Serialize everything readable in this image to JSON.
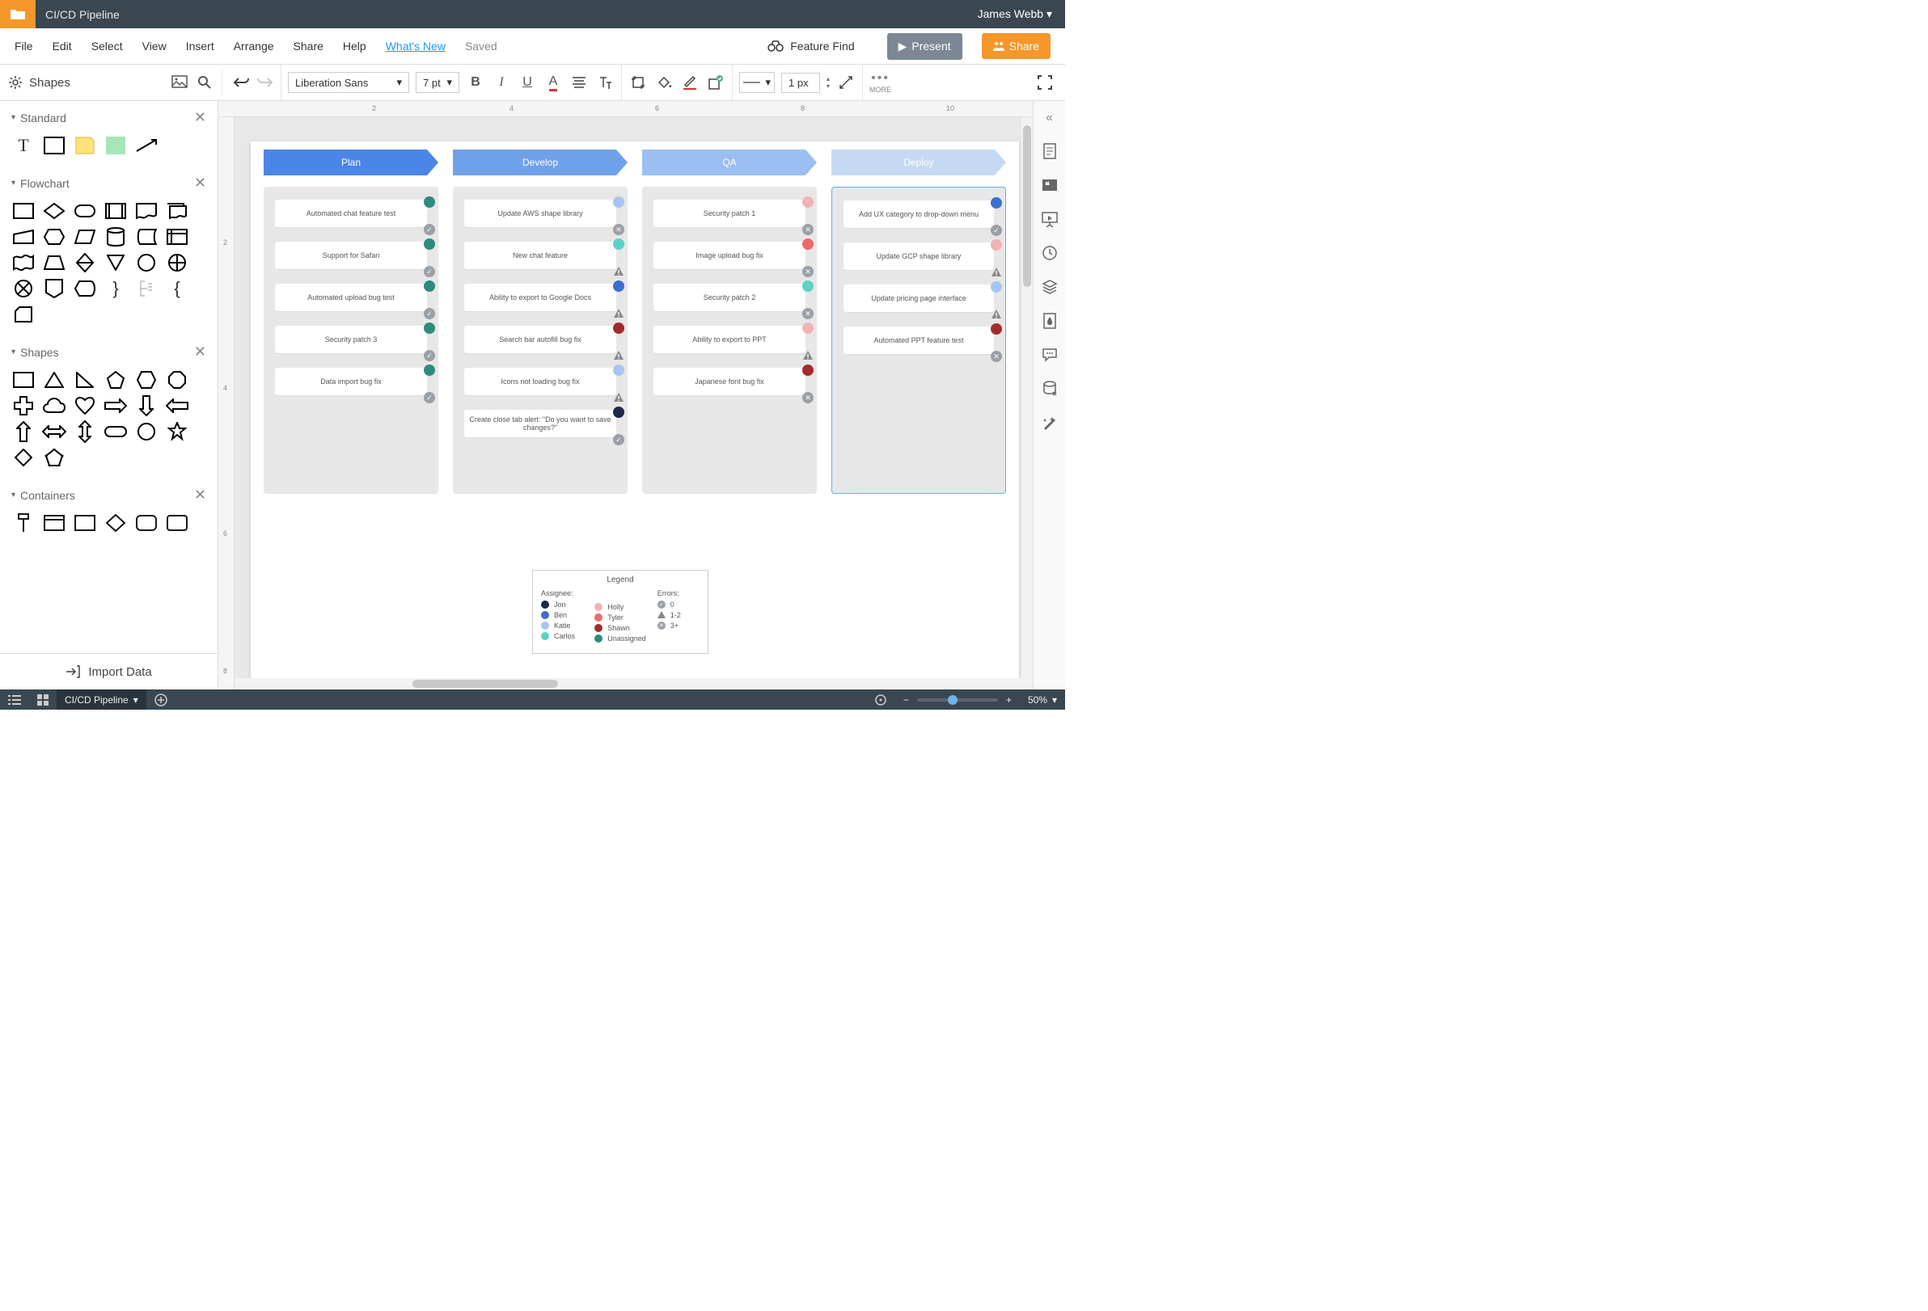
{
  "topbar": {
    "doc_title": "CI/CD Pipeline",
    "user_name": "James Webb"
  },
  "menu": {
    "items": [
      "File",
      "Edit",
      "Select",
      "View",
      "Insert",
      "Arrange",
      "Share",
      "Help"
    ],
    "whats_new": "What's New",
    "saved": "Saved",
    "feature_find": "Feature Find",
    "present": "Present",
    "share": "Share"
  },
  "toolbar": {
    "shapes_label": "Shapes",
    "font": "Liberation Sans",
    "font_size": "7 pt",
    "line_width": "1 px",
    "more_label": "MORE"
  },
  "left": {
    "categories": [
      {
        "name": "Standard"
      },
      {
        "name": "Flowchart"
      },
      {
        "name": "Shapes"
      },
      {
        "name": "Containers"
      }
    ],
    "import_label": "Import Data"
  },
  "right_rail": {
    "items": [
      "collapse",
      "page",
      "quote",
      "export",
      "clock",
      "layers",
      "ink",
      "comment",
      "data",
      "magic"
    ]
  },
  "ruler_h": [
    "2",
    "4",
    "6",
    "8",
    "10"
  ],
  "ruler_v": [
    "2",
    "4",
    "6",
    "8"
  ],
  "kanban": {
    "columns": [
      {
        "title": "Plan",
        "color": "#4a86e8",
        "cards": [
          {
            "text": "Automated chat feature test",
            "assignee": "#2e8b7b",
            "status": "check"
          },
          {
            "text": "Support for Safari",
            "assignee": "#2e8b7b",
            "status": "check"
          },
          {
            "text": "Automated upload bug test",
            "assignee": "#2e8b7b",
            "status": "check"
          },
          {
            "text": "Security patch 3",
            "assignee": "#2e8b7b",
            "status": "check"
          },
          {
            "text": "Data import bug fix",
            "assignee": "#2e8b7b",
            "status": "check"
          }
        ]
      },
      {
        "title": "Develop",
        "color": "#6fa1eb",
        "cards": [
          {
            "text": "Update AWS shape library",
            "assignee": "#a7c5f2",
            "status": "x"
          },
          {
            "text": "New chat feature",
            "assignee": "#5fd1c8",
            "status": "warn"
          },
          {
            "text": "Ability to export to Google Docs",
            "assignee": "#3c6fd1",
            "status": "warn"
          },
          {
            "text": "Search bar autofill bug fix",
            "assignee": "#a32c2c",
            "status": "warn"
          },
          {
            "text": "Icons not loading bug fix",
            "assignee": "#a7c5f2",
            "status": "warn"
          },
          {
            "text": "Create close tab alert: \"Do you want to save changes?\"",
            "assignee": "#1b2a4a",
            "status": "check"
          }
        ]
      },
      {
        "title": "QA",
        "color": "#9bbff2",
        "cards": [
          {
            "text": "Security patch 1",
            "assignee": "#f1b3b3",
            "status": "x"
          },
          {
            "text": "Image upload bug fix",
            "assignee": "#ec6a6a",
            "status": "x"
          },
          {
            "text": "Security patch 2",
            "assignee": "#5fd1c8",
            "status": "x"
          },
          {
            "text": "Ability to export to PPT",
            "assignee": "#f1b3b3",
            "status": "warn"
          },
          {
            "text": "Japanese font bug fix",
            "assignee": "#a32c2c",
            "status": "x"
          }
        ]
      },
      {
        "title": "Deploy",
        "color": "#c5d9f5",
        "selected": true,
        "cards": [
          {
            "text": "Add UX category to drop-down menu",
            "assignee": "#3c6fd1",
            "status": "check"
          },
          {
            "text": "Update GCP shape library",
            "assignee": "#f1b3b3",
            "status": "warn"
          },
          {
            "text": "Update pricing page interface",
            "assignee": "#a7c5f2",
            "status": "warn"
          },
          {
            "text": "Automated PPT feature test",
            "assignee": "#a32c2c",
            "status": "x"
          }
        ]
      }
    ]
  },
  "legend": {
    "title": "Legend",
    "assignee_label": "Assignee:",
    "assignees": [
      {
        "name": "Jon",
        "color": "#1b2a4a"
      },
      {
        "name": "Ben",
        "color": "#3c6fd1"
      },
      {
        "name": "Katie",
        "color": "#a7c5f2"
      },
      {
        "name": "Carlos",
        "color": "#5fd1c8"
      }
    ],
    "assignees2": [
      {
        "name": "Holly",
        "color": "#f1b3b3"
      },
      {
        "name": "Tyler",
        "color": "#ec6a6a"
      },
      {
        "name": "Shawn",
        "color": "#a32c2c"
      },
      {
        "name": "Unassigned",
        "color": "#2e8b7b"
      }
    ],
    "errors_label": "Errors:",
    "errors": [
      {
        "icon": "check",
        "label": "0"
      },
      {
        "icon": "warn",
        "label": "1-2"
      },
      {
        "icon": "x",
        "label": "3+"
      }
    ]
  },
  "statusbar": {
    "doc_tab": "CI/CD Pipeline",
    "zoom": "50%"
  }
}
